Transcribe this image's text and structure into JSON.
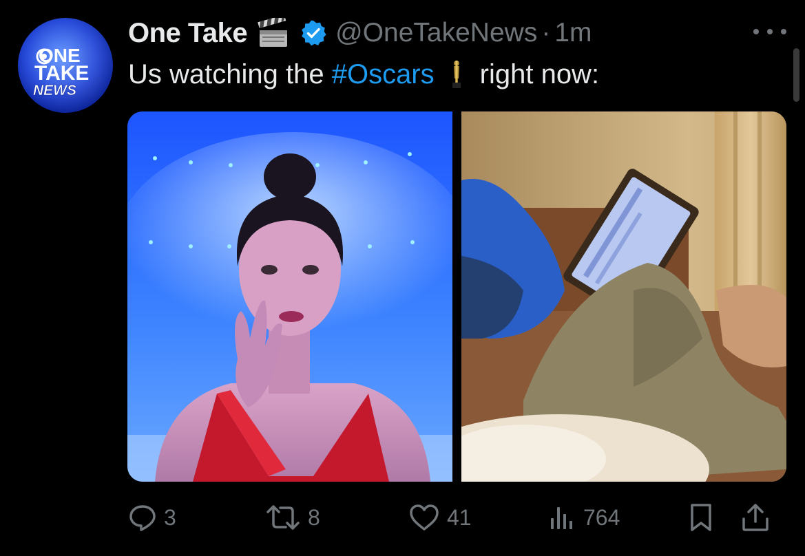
{
  "avatar": {
    "lines": [
      "ONE",
      "TAKE",
      "NEWS"
    ]
  },
  "tweet": {
    "display_name": "One Take",
    "handle": "@OneTakeNews",
    "separator": "·",
    "time": "1m",
    "text_before": "Us watching the ",
    "hashtag": "#Oscars",
    "text_after": "right now:"
  },
  "icons": {
    "name_emoji": "clapper-board-icon",
    "verified": "verified-badge-icon",
    "trophy": "oscar-trophy-icon",
    "more": "more-dots-icon"
  },
  "actions": {
    "reply_count": "3",
    "retweet_count": "8",
    "like_count": "41",
    "views_count": "764"
  },
  "colors": {
    "background": "#000000",
    "text": "#e7e9ea",
    "muted": "#71767b",
    "accent": "#1d9bf0"
  }
}
